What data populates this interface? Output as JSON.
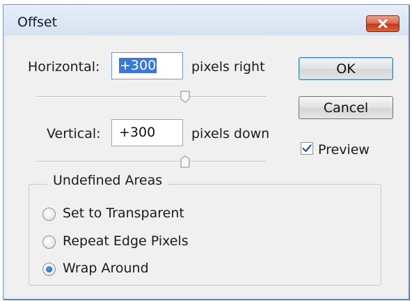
{
  "window": {
    "title": "Offset",
    "close_icon": "close-icon",
    "accent": "#c0391e"
  },
  "horizontal": {
    "label": "Horizontal:",
    "value": "+300",
    "unit": "pixels right",
    "slider_value": 0.5
  },
  "vertical": {
    "label": "Vertical:",
    "value": "+300",
    "unit": "pixels down",
    "slider_value": 0.5
  },
  "buttons": {
    "ok_label": "OK",
    "cancel_label": "Cancel"
  },
  "preview": {
    "label": "Preview",
    "checked": true
  },
  "undefined_areas": {
    "title": "Undefined Areas",
    "options": [
      {
        "label": "Set to Transparent",
        "selected": false
      },
      {
        "label": "Repeat Edge Pixels",
        "selected": false
      },
      {
        "label": "Wrap Around",
        "selected": true
      }
    ]
  }
}
